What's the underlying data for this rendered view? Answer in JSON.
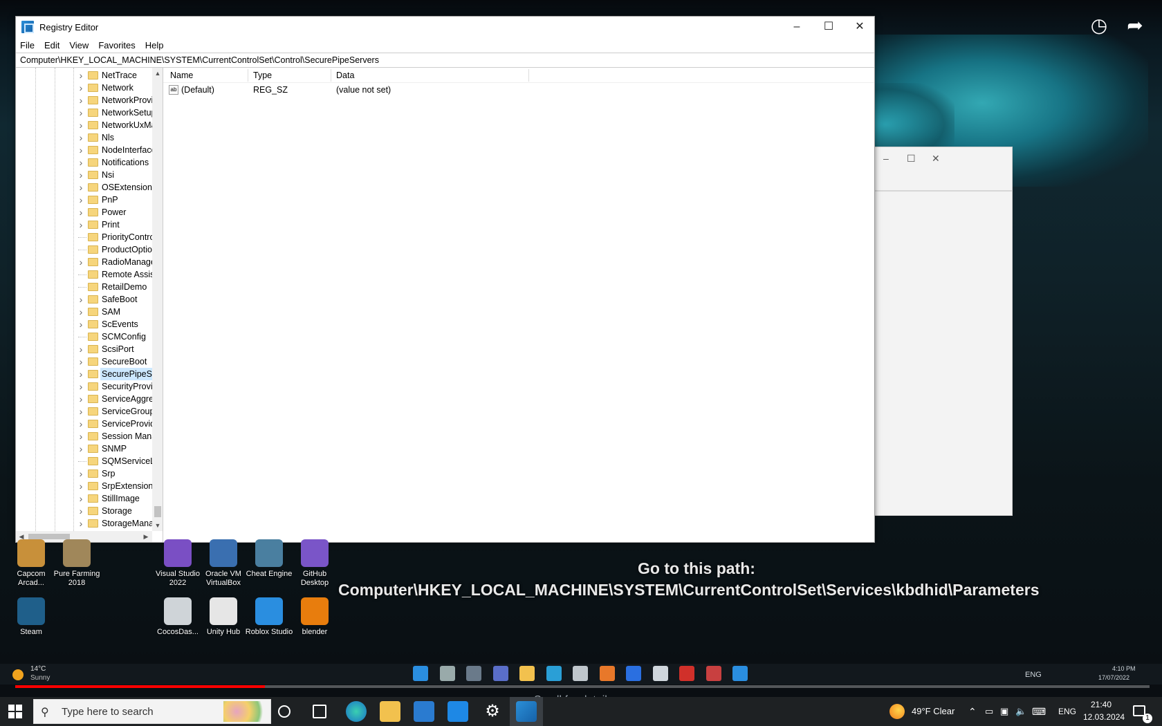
{
  "window": {
    "title": "Registry Editor",
    "minimize": "–",
    "maximize": "☐",
    "close": "✕",
    "menu": [
      "File",
      "Edit",
      "View",
      "Favorites",
      "Help"
    ],
    "address": "Computer\\HKEY_LOCAL_MACHINE\\SYSTEM\\CurrentControlSet\\Control\\SecurePipeServers"
  },
  "tree": {
    "items": [
      {
        "label": "NetTrace",
        "expandable": true
      },
      {
        "label": "Network",
        "expandable": true
      },
      {
        "label": "NetworkProvi",
        "expandable": true
      },
      {
        "label": "NetworkSetup",
        "expandable": true
      },
      {
        "label": "NetworkUxMa",
        "expandable": true
      },
      {
        "label": "Nls",
        "expandable": true
      },
      {
        "label": "NodeInterface",
        "expandable": true
      },
      {
        "label": "Notifications",
        "expandable": true
      },
      {
        "label": "Nsi",
        "expandable": true
      },
      {
        "label": "OSExtensionD",
        "expandable": true
      },
      {
        "label": "PnP",
        "expandable": true
      },
      {
        "label": "Power",
        "expandable": true
      },
      {
        "label": "Print",
        "expandable": true
      },
      {
        "label": "PriorityContro",
        "expandable": false
      },
      {
        "label": "ProductOption",
        "expandable": false
      },
      {
        "label": "RadioManage",
        "expandable": true
      },
      {
        "label": "Remote Assist",
        "expandable": false
      },
      {
        "label": "RetailDemo",
        "expandable": false
      },
      {
        "label": "SafeBoot",
        "expandable": true
      },
      {
        "label": "SAM",
        "expandable": true
      },
      {
        "label": "ScEvents",
        "expandable": true
      },
      {
        "label": "SCMConfig",
        "expandable": false
      },
      {
        "label": "ScsiPort",
        "expandable": true
      },
      {
        "label": "SecureBoot",
        "expandable": true
      },
      {
        "label": "SecurePipeSer",
        "expandable": true,
        "selected": true
      },
      {
        "label": "SecurityProvic",
        "expandable": true
      },
      {
        "label": "ServiceAggreg",
        "expandable": true
      },
      {
        "label": "ServiceGroupC",
        "expandable": true
      },
      {
        "label": "ServiceProvide",
        "expandable": true
      },
      {
        "label": "Session Manag",
        "expandable": true
      },
      {
        "label": "SNMP",
        "expandable": true
      },
      {
        "label": "SQMServiceLis",
        "expandable": false
      },
      {
        "label": "Srp",
        "expandable": true
      },
      {
        "label": "SrpExtensionC",
        "expandable": true
      },
      {
        "label": "StillImage",
        "expandable": true
      },
      {
        "label": "Storage",
        "expandable": true
      },
      {
        "label": "StorageManag",
        "expandable": true
      }
    ]
  },
  "values_pane": {
    "columns": [
      "Name",
      "Type",
      "Data"
    ],
    "rows": [
      {
        "icon": "ab",
        "name": "(Default)",
        "type": "REG_SZ",
        "data": "(value not set)"
      }
    ]
  },
  "desktop_icons": [
    {
      "label": "Capcom Arcad...",
      "color": "#c8903a"
    },
    {
      "label": "Pure Farming 2018",
      "color": "#a0875a"
    },
    {
      "label": "Visual Studio 2022",
      "color": "#7a4fc4"
    },
    {
      "label": "Oracle VM VirtualBox",
      "color": "#3a6fb0"
    },
    {
      "label": "Cheat Engine",
      "color": "#4a7fa0"
    },
    {
      "label": "GitHub Desktop",
      "color": "#7a55c8"
    },
    {
      "label": "Steam",
      "color": "#1f5f8a"
    },
    {
      "label": "CocosDas...",
      "color": "#cfd4d8"
    },
    {
      "label": "Unity Hub",
      "color": "#e6e6e6"
    },
    {
      "label": "Roblox Studio",
      "color": "#2a8ee0"
    },
    {
      "label": "blender",
      "color": "#e87d0d"
    }
  ],
  "video": {
    "instruction_line1": "Go to this path:",
    "instruction_line2": "Computer\\HKEY_LOCAL_MACHINE\\SYSTEM\\CurrentControlSet\\Services\\kbdhid\\Parameters",
    "progress_fraction": 0.22,
    "scroll_hint": "Scroll for details",
    "weather_temp": "14°C",
    "weather_desc": "Sunny",
    "tray_lang": "ENG",
    "tray_time": "4:10 PM",
    "tray_date": "17/07/2022"
  },
  "taskbar": {
    "search_placeholder": "Type here to search",
    "weather": "49°F  Clear",
    "language": "ENG",
    "time": "21:40",
    "date": "12.03.2024",
    "notification_count": "1"
  }
}
